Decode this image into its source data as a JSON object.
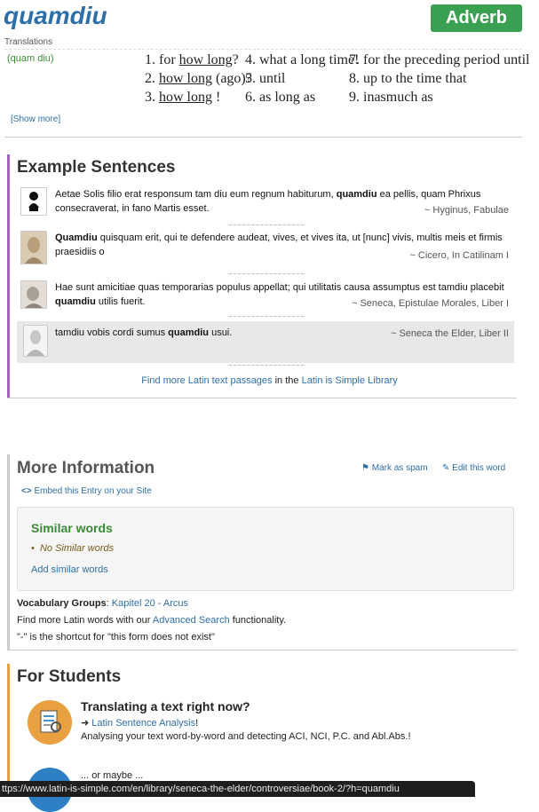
{
  "header": {
    "word": "quamdiu",
    "pos": "Adverb",
    "translations_label": "Translations",
    "paren": "(quam diu)",
    "show_more": "[Show more]"
  },
  "translations": {
    "t1_num": "1.",
    "t1_a": "for",
    "t1_b": "how long",
    "t1_c": "?",
    "t2_num": "2.",
    "t2_b": "how long",
    "t2_c": "(ago)?",
    "t3_num": "3.",
    "t3_b": "how long",
    "t3_c": "!",
    "t4": "4. what a long time!",
    "t5": "5. until",
    "t6": "6. as long as",
    "t7": "7. for the preceding period until",
    "t8": "8. up to the time that",
    "t9": "9. inasmuch as"
  },
  "examples": {
    "title": "Example Sentences",
    "items": [
      {
        "pre": "Aetae Solis filio erat responsum tam diu eum regnum habiturum, ",
        "bold": "quamdiu",
        "post": " ea pellis, quam Phrixus consecraverat, in fano Martis esset.",
        "source": "~ Hyginus, Fabulae"
      },
      {
        "pre": "",
        "bold": "Quamdiu",
        "post": " quisquam erit, qui te defendere audeat, vives, et vives ita, ut [nunc] vivis, multis meis et firmis praesidiis o",
        "source": "~ Cicero, In Catilinam I"
      },
      {
        "pre": "Hae sunt amicitiae quas temporarias populus appellat; qui utilitatis causa assumptus est tamdiu placebit ",
        "bold": "quamdiu",
        "post": " utilis fuerit.",
        "source": "~ Seneca, Epistulae Morales, Liber I"
      },
      {
        "pre": "tamdiu vobis cordi sumus ",
        "bold": "quamdiu",
        "post": " usui.",
        "source": "~ Seneca the Elder, Liber II"
      }
    ],
    "find_more_link": "Find more Latin text passages",
    "find_more_mid": " in the ",
    "library_link": "Latin is Simple Library"
  },
  "more_info": {
    "title": "More Information",
    "mark_spam": "Mark as spam",
    "edit_word": "Edit this word",
    "embed": "Embed this Entry on your Site",
    "similar_title": "Similar words",
    "no_similar": "No Similar words",
    "add_similar": "Add similar words",
    "vocab_label": "Vocabulary Groups",
    "vocab_colon": ": ",
    "vocab_link": "Kapitel 20 - Arcus",
    "find_pre": "Find more Latin words with our ",
    "advanced_search": "Advanced Search",
    "find_post": " functionality.",
    "shortcut": "\"-\" is the shortcut for \"this form does not exist\""
  },
  "students": {
    "title": "For Students",
    "heading": "Translating a text right now?",
    "arrow": "➜",
    "analysis_link": "Latin Sentence Analysis",
    "analysis_exclaim": "!",
    "desc": "Analysing your text word-by-word and detecting ACI, NCI, P.C. and Abl.Abs.!",
    "or_maybe": "... or maybe ..."
  },
  "status_url": "ttps://www.latin-is-simple.com/en/library/seneca-the-elder/controversiae/book-2/?h=quamdiu",
  "colors": {
    "accent": "#2f6fa8",
    "badge": "#3aa152",
    "examples_bar": "#a55fbf",
    "students_bar": "#e8a040",
    "similar_title": "#3a8a35"
  }
}
